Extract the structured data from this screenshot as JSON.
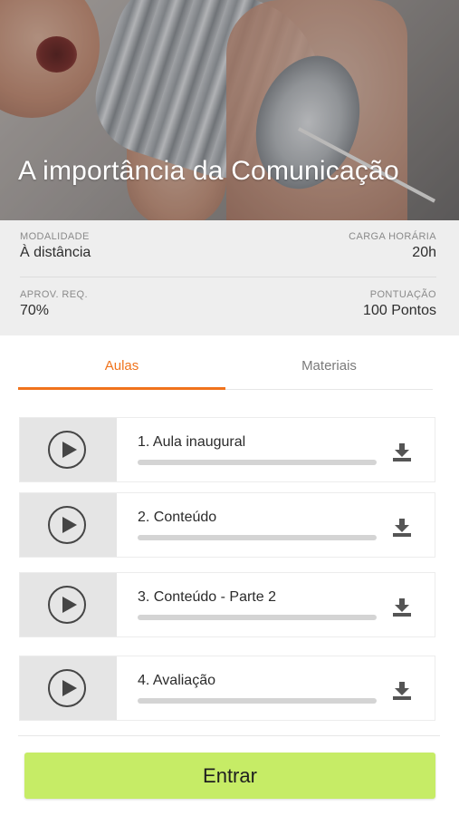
{
  "course": {
    "title": "A importância da Comunicação"
  },
  "info": {
    "modalidade_label": "MODALIDADE",
    "modalidade_value": "À distância",
    "carga_label": "CARGA HORÁRIA",
    "carga_value": "20h",
    "aprov_label": "APROV. REQ.",
    "aprov_value": "70%",
    "pontuacao_label": "PONTUAÇÃO",
    "pontuacao_value": "100 Pontos"
  },
  "tabs": [
    {
      "label": "Aulas",
      "active": true
    },
    {
      "label": "Materiais",
      "active": false
    }
  ],
  "lessons": [
    {
      "title": "1. Aula inaugural",
      "progress": 0
    },
    {
      "title": "2. Conteúdo",
      "progress": 0
    },
    {
      "title": "3. Conteúdo - Parte 2",
      "progress": 0
    },
    {
      "title": "4. Avaliação",
      "progress": 0
    }
  ],
  "enter_button": "Entrar",
  "colors": {
    "accent": "#f0731c",
    "button": "#c6ec66",
    "info_bg": "#eeeeee"
  },
  "icons": {
    "play": "play-circle-icon",
    "download": "download-icon"
  }
}
